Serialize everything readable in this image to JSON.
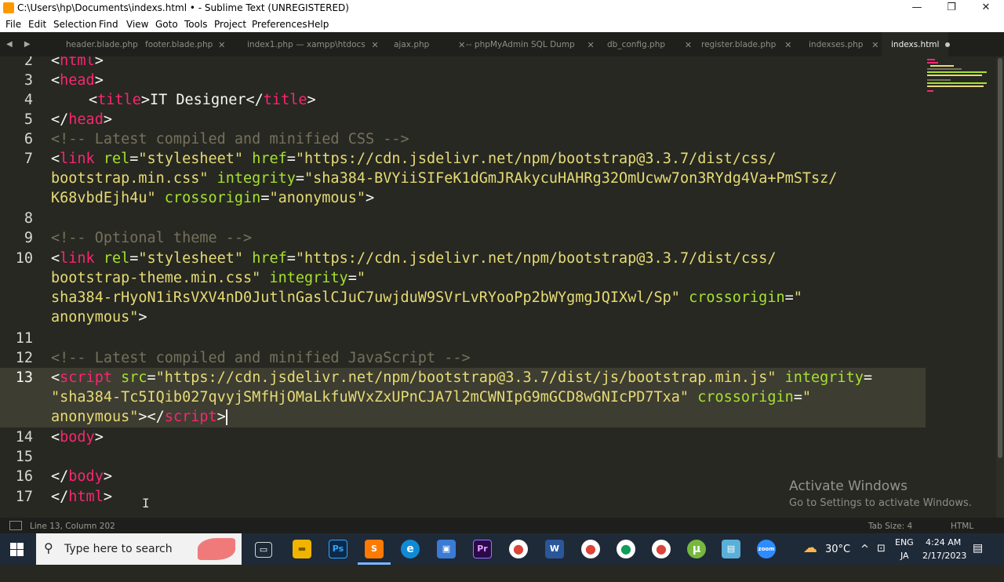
{
  "window": {
    "title": "C:\\Users\\hp\\Documents\\indexs.html • - Sublime Text (UNREGISTERED)",
    "minimize": "—",
    "restore": "❐",
    "close": "✕"
  },
  "menu": [
    "File",
    "Edit",
    "Selection",
    "Find",
    "View",
    "Goto",
    "Tools",
    "Project",
    "Preferences",
    "Help"
  ],
  "tab_nav": "◀ ▶",
  "tabs": [
    {
      "label": "header.blade.php",
      "close": ""
    },
    {
      "label": "footer.blade.php",
      "close": "✕"
    },
    {
      "label": "index1.php — xampp\\htdocs",
      "close": "✕"
    },
    {
      "label": "ajax.php",
      "close": "✕"
    },
    {
      "label": "-- phpMyAdmin SQL Dump",
      "close": "✕"
    },
    {
      "label": "db_config.php",
      "close": "✕"
    },
    {
      "label": "register.blade.php",
      "close": "✕"
    },
    {
      "label": "indexses.php",
      "close": "✕"
    },
    {
      "label": "indexs.html",
      "close": ""
    }
  ],
  "editor": {
    "line_numbers": [
      "2",
      "3",
      "4",
      "5",
      "6",
      "7",
      "8",
      "9",
      "10",
      "11",
      "12",
      "13",
      "14",
      "15",
      "16",
      "17"
    ],
    "l2": {
      "open": "<",
      "tag": "html",
      "close": ">"
    },
    "l3": {
      "open": "<",
      "tag": "head",
      "close": ">"
    },
    "l4": {
      "open": "<",
      "tag": "title",
      "close": ">",
      "text": "IT Designer",
      "end_open": "</",
      "end_tag": "title",
      "end_close": ">"
    },
    "l5": {
      "open": "</",
      "tag": "head",
      "close": ">"
    },
    "l6": "<!-- Latest compiled and minified CSS -->",
    "l7": {
      "open": "<",
      "tag": "link",
      "a1": " rel",
      "eq1": "=",
      "v1": "\"stylesheet\"",
      "a2": " href",
      "eq2": "=",
      "v2": "\"https://cdn.jsdelivr.net/npm/bootstrap@3.3.7/dist/css/",
      "w2_v": "bootstrap.min.css\"",
      "w2_a": " integrity",
      "w2_eq": "=",
      "w2_v2": "\"sha384-BVYiiSIFeK1dGmJRAkycuHAHRg32OmUcww7on3RYdg4Va+PmSTsz/",
      "w3_v": "K68vbdEjh4u\"",
      "w3_a": " crossorigin",
      "w3_eq": "=",
      "w3_v2": "\"anonymous\"",
      "w3_close": ">"
    },
    "l9": "<!-- Optional theme -->",
    "l10": {
      "open": "<",
      "tag": "link",
      "a1": " rel",
      "eq1": "=",
      "v1": "\"stylesheet\"",
      "a2": " href",
      "eq2": "=",
      "v2": "\"https://cdn.jsdelivr.net/npm/bootstrap@3.3.7/dist/css/",
      "w2_v": "bootstrap-theme.min.css\"",
      "w2_a": " integrity",
      "w2_eq": "=",
      "w2_v2": "\"",
      "w3_v": "sha384-rHyoN1iRsVXV4nD0JutlnGaslCJuC7uwjduW9SVrLvRYooPp2bWYgmgJQIXwl/Sp\"",
      "w3_a": " crossorigin",
      "w3_eq": "=",
      "w3_v2": "\"",
      "w4_v": "anonymous\"",
      "w4_close": ">"
    },
    "l12": "<!-- Latest compiled and minified JavaScript -->",
    "l13": {
      "open": "<",
      "tag": "script",
      "a1": " src",
      "eq1": "=",
      "v1": "\"https://cdn.jsdelivr.net/npm/bootstrap@3.3.7/dist/js/bootstrap.min.js\"",
      "a2": " integrity",
      "eq2": "=",
      "w2_v": "\"sha384-Tc5IQib027qvyjSMfHjOMaLkfuWVxZxUPnCJA7l2mCWNIpG9mGCD8wGNIcPD7Txa\"",
      "w2_a": " crossorigin",
      "w2_eq": "=",
      "w2_v2": "\"",
      "w3_v": "anonymous\"",
      "w3_close": ">",
      "w3_end_open": "</",
      "w3_end_tag": "script",
      "w3_end_close": ">"
    },
    "l14": {
      "open": "<",
      "tag": "body",
      "close": ">"
    },
    "l16": {
      "open": "</",
      "tag": "body",
      "close": ">"
    },
    "l17": {
      "open": "</",
      "tag": "html",
      "close": ">"
    }
  },
  "watermark": {
    "line1": "Activate Windows",
    "line2": "Go to Settings to activate Windows."
  },
  "status": {
    "position": "Line 13, Column 202",
    "tab_size": "Tab Size: 4",
    "syntax": "HTML"
  },
  "taskbar": {
    "search_placeholder": "Type here to search",
    "apps": [
      {
        "name": "task-view",
        "glyph": "▭",
        "color": "#1f2a38"
      },
      {
        "name": "file-explorer",
        "glyph": "▬",
        "color": "#f0b400"
      },
      {
        "name": "photoshop",
        "glyph": "Ps",
        "color": "#0b2a4a"
      },
      {
        "name": "sublime-text",
        "glyph": "S",
        "color": "#ff7a00"
      },
      {
        "name": "edge",
        "glyph": "e",
        "color": "#0f8bd6"
      },
      {
        "name": "store",
        "glyph": "▣",
        "color": "#3a7bd5"
      },
      {
        "name": "premiere",
        "glyph": "Pr",
        "color": "#2a0a4a"
      },
      {
        "name": "chrome",
        "glyph": "●",
        "color": "#db4437"
      },
      {
        "name": "word",
        "glyph": "W",
        "color": "#2b579a"
      },
      {
        "name": "chrome-2",
        "glyph": "●",
        "color": "#db4437"
      },
      {
        "name": "chrome-3",
        "glyph": "●",
        "color": "#0f9d58"
      },
      {
        "name": "chrome-4",
        "glyph": "●",
        "color": "#db4437"
      },
      {
        "name": "utorrent",
        "glyph": "µ",
        "color": "#76b83f"
      },
      {
        "name": "notepad",
        "glyph": "▤",
        "color": "#5ab0d8"
      },
      {
        "name": "zoom",
        "glyph": "zoom",
        "color": "#2d8cff"
      }
    ],
    "weather": "30°C",
    "tray_up": "^",
    "language": "ENG",
    "ime": "JA",
    "time": "4:24 AM",
    "date": "2/17/2023"
  }
}
